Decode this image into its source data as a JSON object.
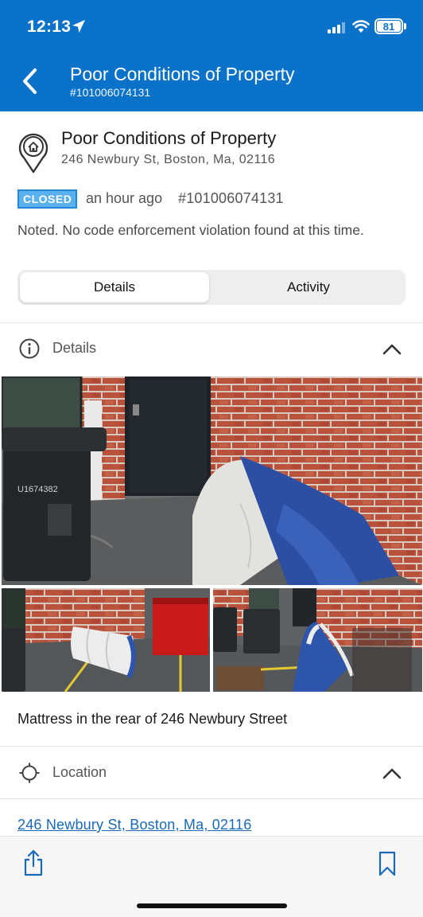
{
  "status_bar": {
    "time": "12:13",
    "battery": "81"
  },
  "header": {
    "title": "Poor Conditions of Property",
    "subtitle": "#101006074131"
  },
  "summary": {
    "title": "Poor Conditions of Property",
    "address": "246 Newbury St, Boston, Ma, 02116",
    "status_badge": "CLOSED",
    "time_ago": "an hour ago",
    "request_id": "#101006074131",
    "resolution_note": "Noted. No code enforcement violation found at this time."
  },
  "tabs": [
    {
      "label": "Details",
      "selected": true
    },
    {
      "label": "Activity",
      "selected": false
    }
  ],
  "details_section": {
    "label": "Details",
    "icon": "info-icon",
    "photos": [
      "mattress-alley-photo",
      "mattress-bins-photo",
      "mattress-wall-photo"
    ],
    "description": "Mattress in the rear of 246 Newbury Street"
  },
  "location_section": {
    "label": "Location",
    "icon": "crosshair-icon",
    "address_link": "246 Newbury St, Boston, Ma, 02116"
  },
  "toolbar": {
    "share_icon": "share-icon",
    "bookmark_icon": "bookmark-icon"
  },
  "colors": {
    "header_bg": "#0a73c9",
    "badge_bg": "#5bb0ee",
    "link": "#1969b8"
  }
}
